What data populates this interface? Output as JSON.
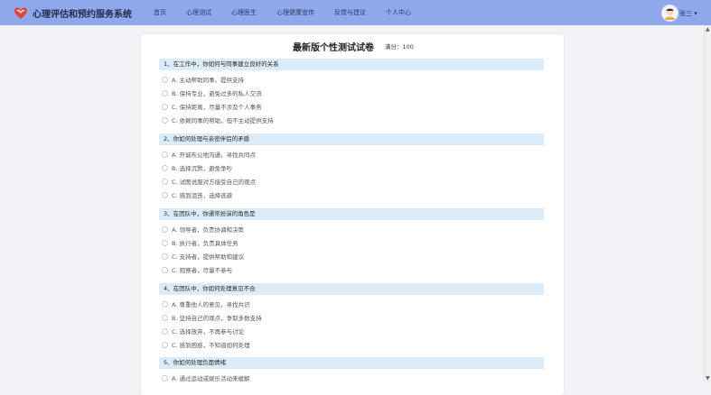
{
  "app": {
    "title": "心理评估和预约服务系统"
  },
  "nav": [
    "首页",
    "心理测试",
    "心理医生",
    "心理健康宣传",
    "反馈与建议",
    "个人中心"
  ],
  "user": {
    "name": "张三 ▾"
  },
  "paper": {
    "title": "最新版个性测试试卷",
    "score": "满分：100"
  },
  "questions": [
    {
      "title": "1、在工作中，你如何与同事建立良好的关系",
      "options": [
        "A. 主动帮助同事，提供支持",
        "B. 保持专业，避免过多的私人交流",
        "C. 保持距离，尽量不涉及个人事务",
        "C. 依赖同事的帮助，但不主动提供支持"
      ]
    },
    {
      "title": "2、你如何处理与亲密伴侣的矛盾",
      "options": [
        "A. 开诚布公地沟通，寻找共同点",
        "B. 选择沉默，避免争吵",
        "C. 试图说服对方接受自己的观点",
        "C. 感到沮丧，选择逃避"
      ]
    },
    {
      "title": "3、在团队中，你通常扮演的角色是",
      "options": [
        "A. 领导者，负责协调和决策",
        "B. 执行者，负责具体任务",
        "C. 支持者，提供帮助和建议",
        "C. 观察者，尽量不参与"
      ]
    },
    {
      "title": "4、在团队中，你如何处理意见不合",
      "options": [
        "A. 尊重他人的意见，寻找共识",
        "B. 坚持自己的观点，争取多数支持",
        "C. 选择放弃，不再参与讨论",
        "C. 感到困惑，不知道如何处理"
      ]
    },
    {
      "title": "5、你如何处理负面情绪",
      "options": [
        "A. 通过运动或娱乐活动来缓解"
      ]
    }
  ]
}
